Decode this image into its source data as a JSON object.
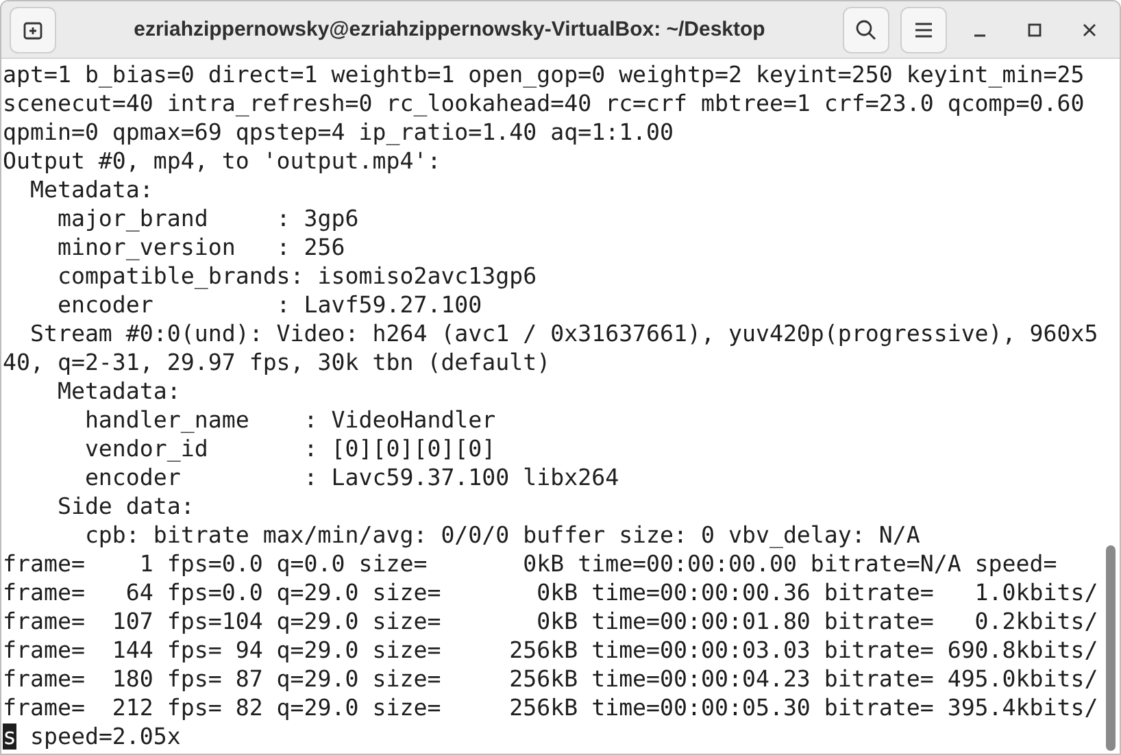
{
  "window": {
    "title": "ezriahzippernowsky@ezriahzippernowsky-VirtualBox: ~/Desktop"
  },
  "terminal": {
    "lines": [
      "apt=1 b_bias=0 direct=1 weightb=1 open_gop=0 weightp=2 keyint=250 keyint_min=25",
      "scenecut=40 intra_refresh=0 rc_lookahead=40 rc=crf mbtree=1 crf=23.0 qcomp=0.60",
      "qpmin=0 qpmax=69 qpstep=4 ip_ratio=1.40 aq=1:1.00",
      "Output #0, mp4, to 'output.mp4':",
      "  Metadata:",
      "    major_brand     : 3gp6",
      "    minor_version   : 256",
      "    compatible_brands: isomiso2avc13gp6",
      "    encoder         : Lavf59.27.100",
      "  Stream #0:0(und): Video: h264 (avc1 / 0x31637661), yuv420p(progressive), 960x5",
      "40, q=2-31, 29.97 fps, 30k tbn (default)",
      "    Metadata:",
      "      handler_name    : VideoHandler",
      "      vendor_id       : [0][0][0][0]",
      "      encoder         : Lavc59.37.100 libx264",
      "    Side data:",
      "      cpb: bitrate max/min/avg: 0/0/0 buffer size: 0 vbv_delay: N/A",
      "frame=    1 fps=0.0 q=0.0 size=       0kB time=00:00:00.00 bitrate=N/A speed=",
      "frame=   64 fps=0.0 q=29.0 size=       0kB time=00:00:00.36 bitrate=   1.0kbits/",
      "frame=  107 fps=104 q=29.0 size=       0kB time=00:00:01.80 bitrate=   0.2kbits/",
      "frame=  144 fps= 94 q=29.0 size=     256kB time=00:00:03.03 bitrate= 690.8kbits/",
      "frame=  180 fps= 87 q=29.0 size=     256kB time=00:00:04.23 bitrate= 495.0kbits/",
      "frame=  212 fps= 82 q=29.0 size=     256kB time=00:00:05.30 bitrate= 395.4kbits/"
    ],
    "cursor_line": {
      "cursor_text": "s",
      "text": " speed=2.05x"
    }
  }
}
